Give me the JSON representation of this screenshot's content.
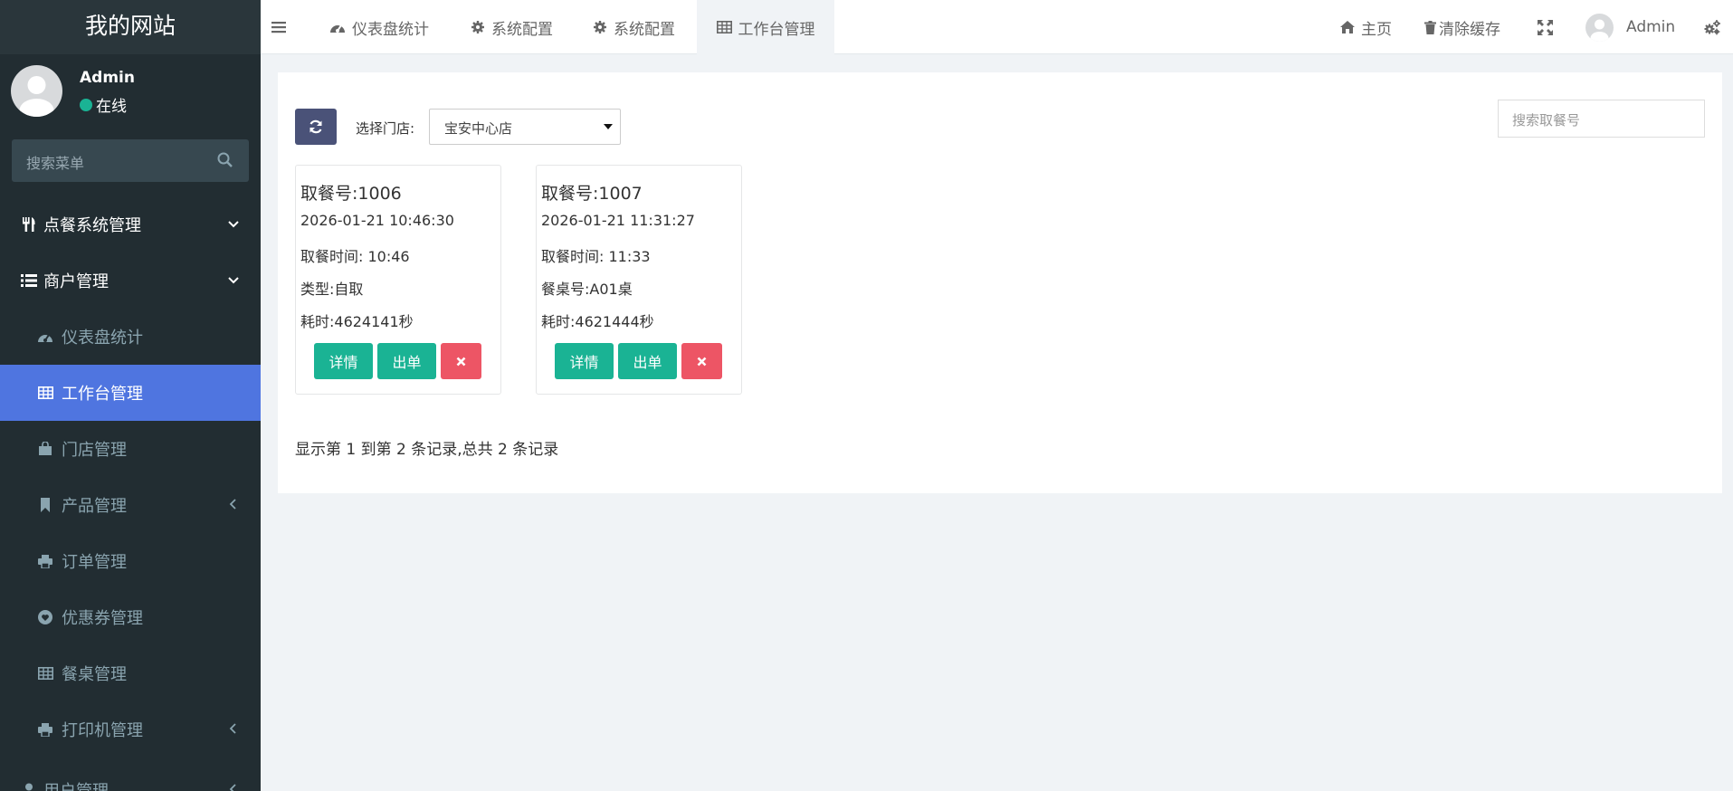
{
  "sidebar": {
    "logo": "我的网站",
    "user": {
      "name": "Admin",
      "status": "在线"
    },
    "search_placeholder": "搜索菜单",
    "items": [
      {
        "label": "点餐系统管理",
        "icon": "cutlery-icon"
      },
      {
        "label": "商户管理",
        "icon": "list-icon"
      },
      {
        "label": "仪表盘统计",
        "icon": "dashboard-icon"
      },
      {
        "label": "工作台管理",
        "icon": "table-icon",
        "active": true
      },
      {
        "label": "门店管理",
        "icon": "shopping-bag-icon"
      },
      {
        "label": "产品管理",
        "icon": "bookmark-icon"
      },
      {
        "label": "订单管理",
        "icon": "print-icon"
      },
      {
        "label": "优惠券管理",
        "icon": "heart-icon"
      },
      {
        "label": "餐桌管理",
        "icon": "table-icon"
      },
      {
        "label": "打印机管理",
        "icon": "print-icon"
      },
      {
        "label": "用户管理",
        "icon": "user-icon"
      }
    ]
  },
  "topbar": {
    "tabs": [
      {
        "label": "仪表盘统计",
        "icon": "dashboard-icon"
      },
      {
        "label": "系统配置",
        "icon": "gear-icon"
      },
      {
        "label": "系统配置",
        "icon": "gear-icon"
      },
      {
        "label": "工作台管理",
        "icon": "table-icon"
      }
    ],
    "home": "主页",
    "clear_cache": "清除缓存",
    "user": "Admin"
  },
  "toolbar": {
    "store_label": "选择门店:",
    "store_value": "宝安中心店",
    "search_placeholder": "搜索取餐号"
  },
  "orders": [
    {
      "no": "取餐号:1006",
      "datetime": "2026-01-21 10:46:30",
      "pickup_time": "取餐时间: 10:46",
      "extra": "类型:自取",
      "duration": "耗时:4624141秒",
      "detail_label": "详情",
      "serve_label": "出单",
      "delete_icon": "times-icon"
    },
    {
      "no": "取餐号:1007",
      "datetime": "2026-01-21 11:31:27",
      "pickup_time": "取餐时间: 11:33",
      "extra": "餐桌号:A01桌",
      "duration": "耗时:4621444秒",
      "detail_label": "详情",
      "serve_label": "出单",
      "delete_icon": "times-icon"
    }
  ],
  "pagination": {
    "info": "显示第 1 到第 2 条记录,总共 2 条记录"
  },
  "colors": {
    "sidebar_bg": "#222d32",
    "active_item": "#4f75e0",
    "green": "#1ab394",
    "red": "#ed5565",
    "refresh_btn": "#4a5278",
    "online": "#1ab394"
  }
}
